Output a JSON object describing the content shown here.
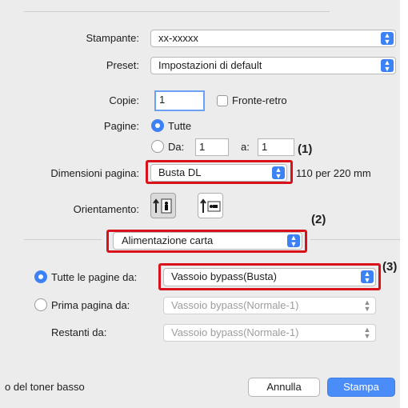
{
  "printer": {
    "label": "Stampante:",
    "value": "xx-xxxxx"
  },
  "preset": {
    "label": "Preset:",
    "value": "Impostazioni di default"
  },
  "copies": {
    "label": "Copie:",
    "value": "1",
    "duplex_label": "Fronte-retro"
  },
  "pages": {
    "label": "Pagine:",
    "all_label": "Tutte",
    "from_label": "Da:",
    "from_value": "1",
    "to_label": "a:",
    "to_value": "1"
  },
  "paper_size": {
    "label": "Dimensioni pagina:",
    "value": "Busta DL",
    "dimensions": "110 per 220 mm"
  },
  "orientation": {
    "label": "Orientamento:"
  },
  "section": {
    "value": "Alimentazione carta"
  },
  "feed": {
    "all_pages_label": "Tutte le pagine da:",
    "all_pages_value": "Vassoio bypass(Busta)",
    "first_page_label": "Prima pagina da:",
    "first_page_value": "Vassoio bypass(Normale-1)",
    "remaining_label": "Restanti da:",
    "remaining_value": "Vassoio bypass(Normale-1)"
  },
  "footer": {
    "status_text": "o del toner basso",
    "cancel_label": "Annulla",
    "print_label": "Stampa"
  },
  "callouts": {
    "c1": "(1)",
    "c2": "(2)",
    "c3": "(3)"
  },
  "colors": {
    "accent": "#3c82f6",
    "callout": "#d9111a"
  },
  "icons": [
    "updown-chevron-icon",
    "portrait-orientation-icon",
    "landscape-orientation-icon"
  ]
}
